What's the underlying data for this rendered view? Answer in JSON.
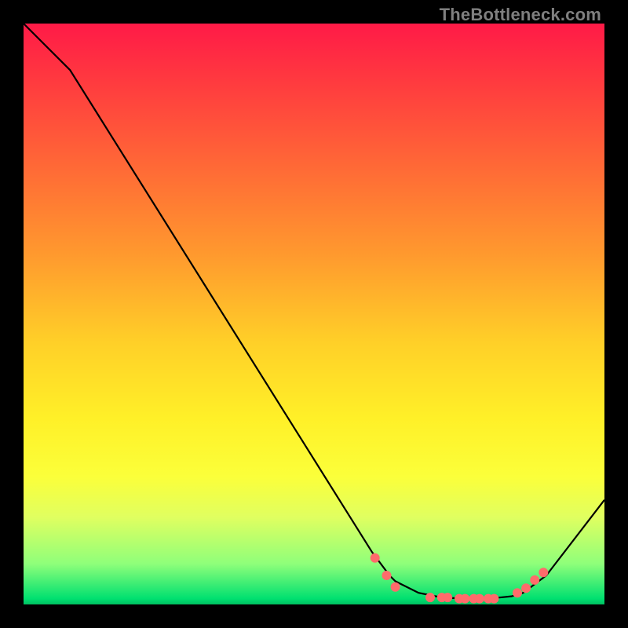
{
  "watermark": "TheBottleneck.com",
  "chart_data": {
    "type": "line",
    "title": "",
    "xlabel": "",
    "ylabel": "",
    "xlim": [
      0,
      100
    ],
    "ylim": [
      0,
      100
    ],
    "grid": false,
    "legend": false,
    "series": [
      {
        "name": "curve",
        "color": "#000000",
        "x": [
          0,
          4,
          8,
          60,
          63,
          64,
          68,
          72,
          76,
          80,
          84,
          86,
          90,
          100
        ],
        "y": [
          100,
          96,
          92,
          9,
          5,
          4,
          2,
          1.2,
          1,
          1,
          1.4,
          2,
          5,
          18
        ]
      }
    ],
    "markers": [
      {
        "name": "marker-1",
        "x": 60.5,
        "y": 8.0,
        "color": "#ff6b6b"
      },
      {
        "name": "marker-2",
        "x": 62.5,
        "y": 5.0,
        "color": "#ff6b6b"
      },
      {
        "name": "marker-3",
        "x": 64.0,
        "y": 3.0,
        "color": "#ff6b6b"
      },
      {
        "name": "marker-4",
        "x": 70.0,
        "y": 1.2,
        "color": "#ff6b6b"
      },
      {
        "name": "marker-5",
        "x": 72.0,
        "y": 1.2,
        "color": "#ff6b6b"
      },
      {
        "name": "marker-6",
        "x": 73.0,
        "y": 1.2,
        "color": "#ff6b6b"
      },
      {
        "name": "marker-7",
        "x": 75.0,
        "y": 1.0,
        "color": "#ff6b6b"
      },
      {
        "name": "marker-8",
        "x": 76.0,
        "y": 1.0,
        "color": "#ff6b6b"
      },
      {
        "name": "marker-9",
        "x": 77.5,
        "y": 1.0,
        "color": "#ff6b6b"
      },
      {
        "name": "marker-10",
        "x": 78.5,
        "y": 1.0,
        "color": "#ff6b6b"
      },
      {
        "name": "marker-11",
        "x": 80.0,
        "y": 1.0,
        "color": "#ff6b6b"
      },
      {
        "name": "marker-12",
        "x": 81.0,
        "y": 1.0,
        "color": "#ff6b6b"
      },
      {
        "name": "marker-13",
        "x": 85.0,
        "y": 2.0,
        "color": "#ff6b6b"
      },
      {
        "name": "marker-14",
        "x": 86.5,
        "y": 2.8,
        "color": "#ff6b6b"
      },
      {
        "name": "marker-15",
        "x": 88.0,
        "y": 4.2,
        "color": "#ff6b6b"
      },
      {
        "name": "marker-16",
        "x": 89.5,
        "y": 5.5,
        "color": "#ff6b6b"
      }
    ]
  }
}
